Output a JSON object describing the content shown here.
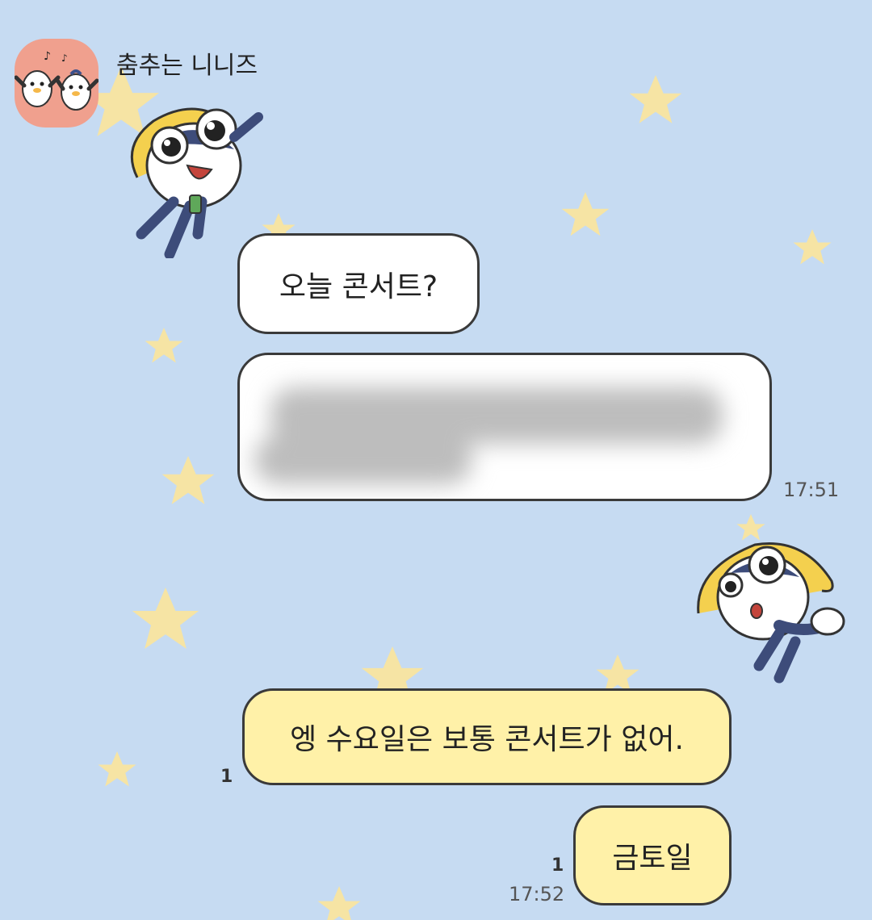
{
  "chat": {
    "partner_name": "춤추는 니니즈",
    "messages": {
      "m1": {
        "text": "오늘 콘서트?"
      },
      "m2": {
        "time": "17:51"
      },
      "m3": {
        "text": "엥 수요일은 보통 콘서트가 없어.",
        "unread": "1"
      },
      "m4": {
        "text": "금토일",
        "unread": "1",
        "time": "17:52"
      }
    }
  },
  "icons": {
    "avatar": "dancing-penguins-icon",
    "sticker_incoming": "keroro-sticker",
    "sticker_outgoing": "keroro-sticker"
  },
  "colors": {
    "background": "#c6dbf2",
    "incoming_bubble": "#ffffff",
    "outgoing_bubble": "#fff1a8",
    "avatar_bg": "#f0a08e",
    "star": "#f6e4a4"
  }
}
